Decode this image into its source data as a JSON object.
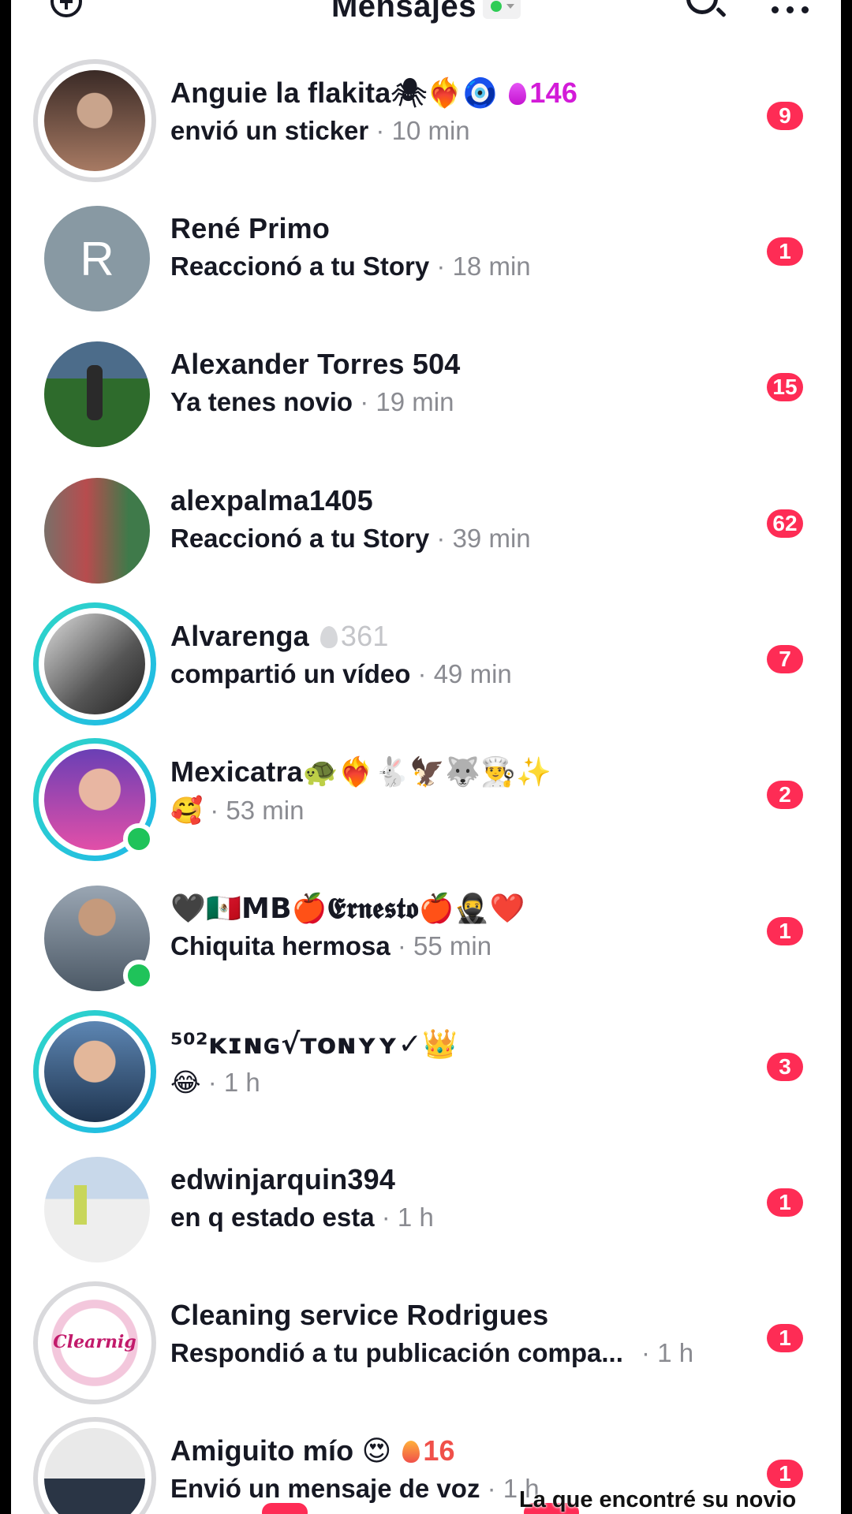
{
  "header": {
    "title": "Mensajes",
    "status_color": "#2ecc55"
  },
  "conversations": [
    {
      "name": "Anguie  la flakita",
      "name_emoji": "🕷❤️‍🔥🧿",
      "streak_count": "146",
      "streak_style": "pink",
      "preview": "envió un sticker",
      "time": "10 min",
      "unread": "9",
      "ring": "gray",
      "online": false
    },
    {
      "name": "René Primo",
      "name_emoji": "",
      "avatar_initial": "R",
      "preview": "Reaccionó a tu Story",
      "time": "18 min",
      "unread": "1",
      "ring": "none",
      "online": false
    },
    {
      "name": "Alexander Torres 504",
      "name_emoji": "",
      "preview": "Ya tenes novio",
      "time": "19 min",
      "unread": "15",
      "ring": "none",
      "online": false
    },
    {
      "name": "alexpalma1405",
      "name_emoji": "",
      "preview": "Reaccionó a tu Story",
      "time": "39 min",
      "unread": "62",
      "ring": "none",
      "online": false
    },
    {
      "name": "Alvarenga",
      "name_emoji": "",
      "streak_count": "361",
      "streak_style": "gray",
      "preview": "compartió un vídeo",
      "time": "49 min",
      "unread": "7",
      "ring": "teal",
      "online": false
    },
    {
      "name": "Mexicatra",
      "name_emoji": "🐢❤️‍🔥🐇🦅🐺👨‍🍳✨",
      "preview": "🥰",
      "time": "53 min",
      "unread": "2",
      "ring": "teal",
      "online": true
    },
    {
      "name": "🖤🇲🇽MB🍎𝕰𝖗𝖓𝖊𝖘𝖙𝖔🍎🥷❤️",
      "name_emoji": "",
      "preview": "Chiquita hermosa",
      "time": "55 min",
      "unread": "1",
      "ring": "none",
      "online": true
    },
    {
      "name": "⁵⁰²ᴋɪɴɢ√ᴛᴏɴʏʏ✓",
      "name_emoji": "👑",
      "preview": "😂",
      "time": "1 h",
      "unread": "3",
      "ring": "teal",
      "online": false
    },
    {
      "name": "edwinjarquin394",
      "name_emoji": "",
      "preview": "en q estado esta",
      "time": "1 h",
      "unread": "1",
      "ring": "none",
      "online": false
    },
    {
      "name": "Cleaning service Rodrigues",
      "name_emoji": "",
      "avatar_text": "Clearnig",
      "preview": "Respondió a tu publicación compa...",
      "time": "1 h",
      "unread": "1",
      "ring": "gray",
      "online": false
    },
    {
      "name": "Amiguito mío",
      "name_emoji": "😍",
      "streak_count": "16",
      "streak_style": "red",
      "preview": "Envió un mensaje de voz",
      "time": "1 h",
      "unread": "1",
      "ring": "gray",
      "online": false
    }
  ],
  "overlay_caption": "La que encontré su novio",
  "colors": {
    "badge": "#fe2c55",
    "teal_ring": "#22c7d8",
    "online": "#1fc35a"
  }
}
